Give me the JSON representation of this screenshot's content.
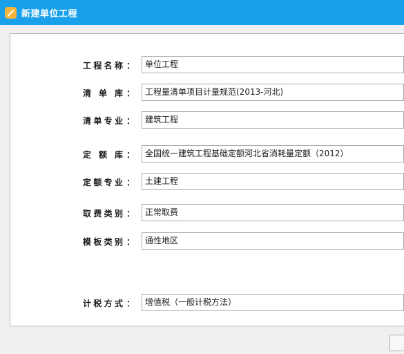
{
  "window": {
    "title": "新建单位工程",
    "app_icon": "app-logo-icon",
    "colors": {
      "titlebar": "#18a0ea",
      "icon": "#f4b53a"
    }
  },
  "form": {
    "fields": [
      {
        "label": "工程名称",
        "value": "单位工程"
      },
      {
        "label": "清单库",
        "value": "工程量清单项目计量规范(2013-河北)"
      },
      {
        "label": "清单专业",
        "value": "建筑工程"
      },
      {
        "label": "定额库",
        "value": "全国统一建筑工程基础定额河北省消耗量定额（2012）"
      },
      {
        "label": "定额专业",
        "value": "土建工程"
      },
      {
        "label": "取费类别",
        "value": "正常取费"
      },
      {
        "label": "模板类别",
        "value": "通性地区"
      },
      {
        "label": "计税方式",
        "value": "增值税（一般计税方法）"
      }
    ],
    "colon": "："
  }
}
